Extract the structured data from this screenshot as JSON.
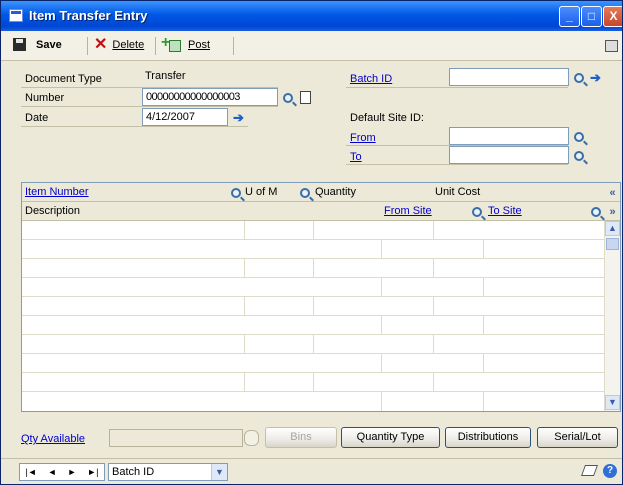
{
  "window": {
    "title": "Item Transfer Entry",
    "min": "_",
    "max": "□",
    "close": "X"
  },
  "toolbar": {
    "save": "Save",
    "delete": "Delete",
    "post": "Post"
  },
  "form": {
    "document_type_label": "Document Type",
    "document_type_value": "Transfer",
    "number_label": "Number",
    "number_value": "00000000000000003",
    "date_label": "Date",
    "date_value": "4/12/2007",
    "batch_id_label": "Batch ID",
    "batch_id_value": "",
    "default_site_label": "Default Site ID:",
    "from_label": "From",
    "from_value": "",
    "to_label": "To",
    "to_value": ""
  },
  "grid": {
    "item_number": "Item Number",
    "u_of_m": "U of M",
    "quantity": "Quantity",
    "unit_cost": "Unit Cost",
    "description": "Description",
    "from_site": "From Site",
    "to_site": "To Site"
  },
  "footer": {
    "qty_available": "Qty Available",
    "bins": "Bins",
    "quantity_type": "Quantity Type",
    "distributions": "Distributions",
    "serial_lot": "Serial/Lot"
  },
  "status": {
    "nav": [
      "|◄",
      "◄",
      "►",
      "►|"
    ],
    "combo_value": "Batch ID"
  }
}
